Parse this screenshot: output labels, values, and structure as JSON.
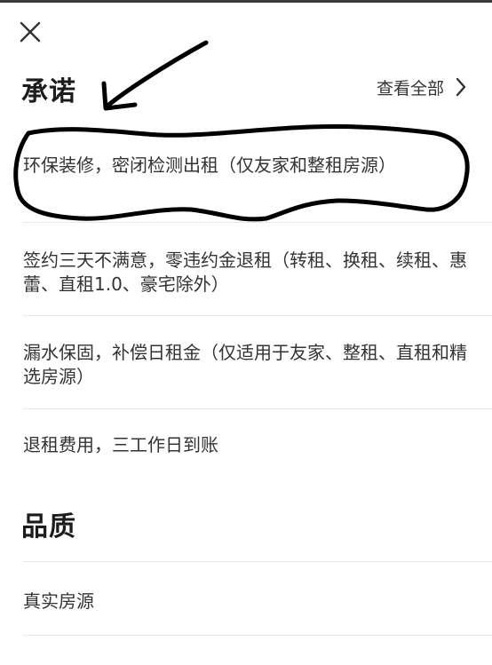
{
  "header": {
    "close_icon": "close-icon"
  },
  "promise_section": {
    "title": "承诺",
    "view_all_label": "查看全部",
    "view_all_icon": "chevron-right-icon",
    "items": [
      {
        "text": "环保装修，密闭检测出租（仅友家和整租房源）"
      },
      {
        "text": "签约三天不满意，零违约金退租（转租、换租、续租、惠蕾、直租1.0、豪宅除外）"
      },
      {
        "text": "漏水保固，补偿日租金（仅适用于友家、整租、直租和精选房源）"
      },
      {
        "text": "退租费用，三工作日到账"
      }
    ]
  },
  "quality_section": {
    "title": "品质",
    "items": [
      {
        "text": "真实房源"
      }
    ]
  },
  "colors": {
    "annotation_ink": "#000000",
    "divider": "#e8e8e8",
    "text": "#333333"
  }
}
